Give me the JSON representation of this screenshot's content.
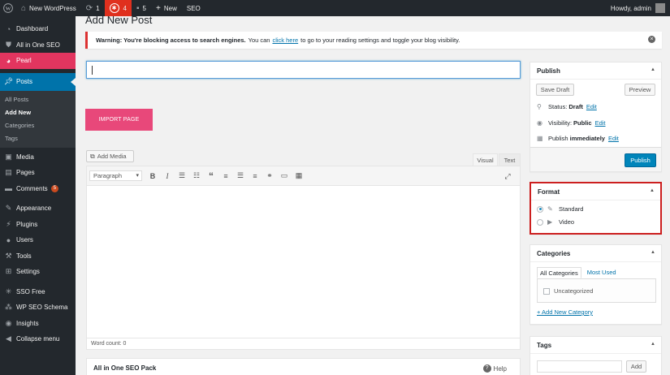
{
  "adminbar": {
    "site_name": "New WordPress",
    "updates_count": "1",
    "pearl_count": "4",
    "comments_count": "5",
    "new_label": "New",
    "seo_label": "SEO",
    "howdy": "Howdy, admin"
  },
  "menu": {
    "items": {
      "dashboard": "Dashboard",
      "aioseo": "All in One SEO",
      "pearl": "Pearl",
      "posts": "Posts",
      "media": "Media",
      "pages": "Pages",
      "comments": "Comments",
      "comments_badge": "5",
      "appearance": "Appearance",
      "plugins": "Plugins",
      "users": "Users",
      "tools": "Tools",
      "settings": "Settings",
      "sso": "SSO Free",
      "wpseo_schema": "WP SEO Schema",
      "insights": "Insights",
      "collapse": "Collapse menu"
    },
    "posts_submenu": [
      "All Posts",
      "Add New",
      "Categories",
      "Tags"
    ]
  },
  "page": {
    "title": "Add New Post",
    "notice_bold": "Warning: You're blocking access to search engines.",
    "notice_pre": "You can",
    "notice_link": "click here",
    "notice_post": "to go to your reading settings and toggle your blog visibility.",
    "import_label": "IMPORT PAGE",
    "add_media": "Add Media",
    "tab_visual": "Visual",
    "tab_text": "Text",
    "format_select": "Paragraph",
    "word_count": "Word count: 0",
    "aioseo_title": "All in One SEO Pack",
    "help": "Help"
  },
  "publish": {
    "title": "Publish",
    "save_draft": "Save Draft",
    "preview": "Preview",
    "status_label": "Status:",
    "status_value": "Draft",
    "visibility_label": "Visibility:",
    "visibility_value": "Public",
    "publish_label": "Publish",
    "publish_value": "immediately",
    "edit": "Edit",
    "publish_button": "Publish"
  },
  "format": {
    "title": "Format",
    "options": [
      "Standard",
      "Video"
    ],
    "selected": "Standard"
  },
  "categories": {
    "title": "Categories",
    "tab_all": "All Categories",
    "tab_most_used": "Most Used",
    "items": [
      "Uncategorized"
    ],
    "add_new": "+ Add New Category"
  },
  "tags": {
    "title": "Tags",
    "add_button": "Add"
  },
  "colors": {
    "adminbar": "#23282d",
    "pearl": "#e2355f",
    "current": "#0073aa",
    "import_button": "#e8487a",
    "publish_button": "#0085ba",
    "format_highlight": "#cc1f1f"
  }
}
